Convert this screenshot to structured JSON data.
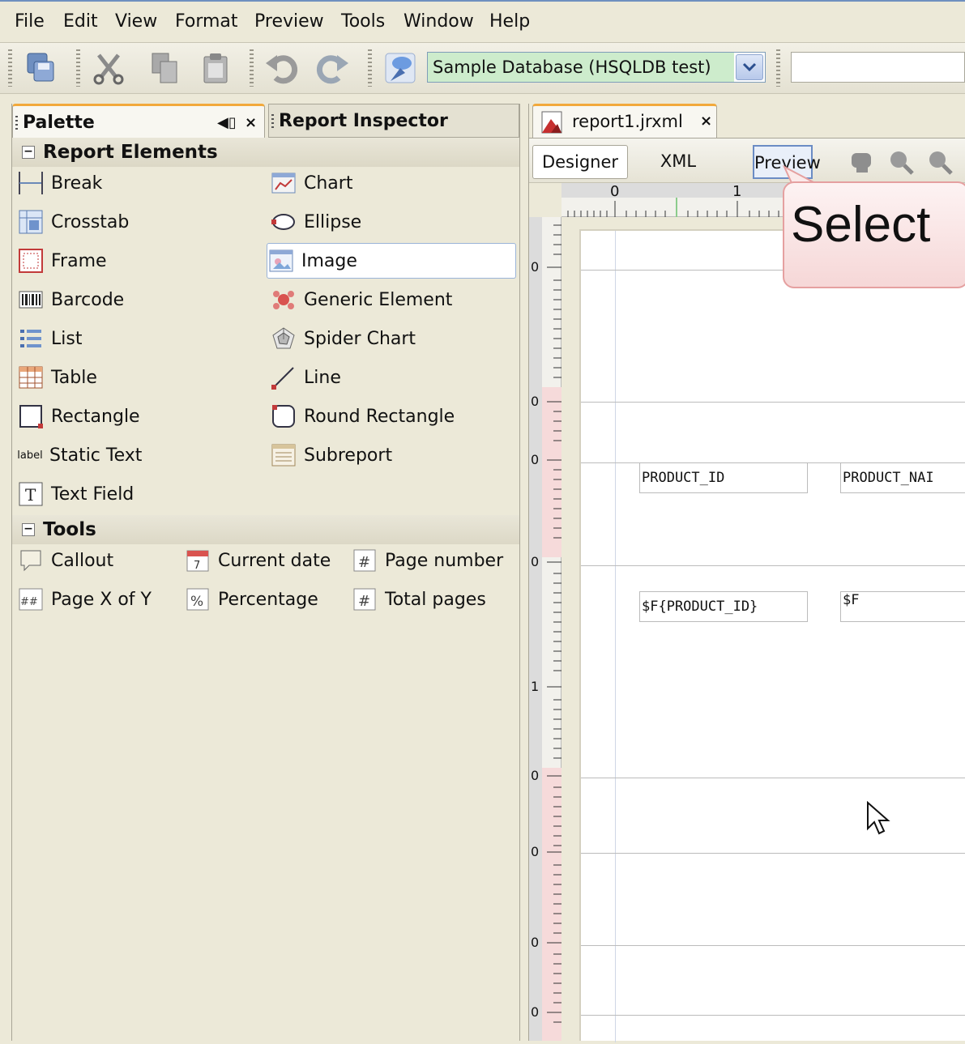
{
  "menu": [
    "File",
    "Edit",
    "View",
    "Format",
    "Preview",
    "Tools",
    "Window",
    "Help"
  ],
  "toolbar": {
    "datasource": "Sample Database (HSQLDB test)",
    "icons": [
      "save-all-icon",
      "cut-icon",
      "copy-icon",
      "paste-icon",
      "undo-icon",
      "redo-icon",
      "datasource-icon"
    ]
  },
  "left_panel": {
    "tab_palette": "Palette",
    "tab_inspector": "Report Inspector",
    "report_elements_header": "Report Elements",
    "report_elements": [
      {
        "label": "Break",
        "icon": "break-icon"
      },
      {
        "label": "Chart",
        "icon": "chart-icon"
      },
      {
        "label": "Crosstab",
        "icon": "crosstab-icon"
      },
      {
        "label": "Ellipse",
        "icon": "ellipse-icon"
      },
      {
        "label": "Frame",
        "icon": "frame-icon"
      },
      {
        "label": "Image",
        "icon": "image-icon",
        "selected": true
      },
      {
        "label": "Barcode",
        "icon": "barcode-icon"
      },
      {
        "label": "Generic Element",
        "icon": "generic-element-icon"
      },
      {
        "label": "List",
        "icon": "list-icon"
      },
      {
        "label": "Spider Chart",
        "icon": "spider-chart-icon"
      },
      {
        "label": "Table",
        "icon": "table-icon"
      },
      {
        "label": "Line",
        "icon": "line-icon"
      },
      {
        "label": "Rectangle",
        "icon": "rectangle-icon"
      },
      {
        "label": "Round Rectangle",
        "icon": "round-rectangle-icon"
      },
      {
        "label": "Static Text",
        "icon": "static-text-icon"
      },
      {
        "label": "Subreport",
        "icon": "subreport-icon"
      },
      {
        "label": "Text Field",
        "icon": "text-field-icon"
      }
    ],
    "static_text_icon_label": "label",
    "tools_header": "Tools",
    "tools": [
      {
        "label": "Callout",
        "icon": "callout-icon"
      },
      {
        "label": "Current date",
        "icon": "current-date-icon"
      },
      {
        "label": "Page number",
        "icon": "page-number-icon"
      },
      {
        "label": "Page X of Y",
        "icon": "page-x-of-y-icon"
      },
      {
        "label": "Percentage",
        "icon": "percentage-icon"
      },
      {
        "label": "Total pages",
        "icon": "total-pages-icon"
      }
    ]
  },
  "editor": {
    "doc_tab": "report1.jrxml",
    "view_tabs": [
      "Designer",
      "XML",
      "Preview"
    ],
    "ruler_marks": [
      "0",
      "1"
    ],
    "vruler_marks": [
      "0",
      "0",
      "0",
      "0",
      "1",
      "0",
      "0",
      "0",
      "0"
    ],
    "fields": {
      "header_product_id": "PRODUCT_ID",
      "header_product_name": "PRODUCT_NAI",
      "detail_product_id": "$F{PRODUCT_ID}",
      "detail_second": "$F"
    },
    "callout_text": "Select"
  },
  "colors": {
    "accent_tab": "#f2a93b",
    "datasource_bg": "#cdeccc",
    "callout_border": "#e5a0a0"
  }
}
